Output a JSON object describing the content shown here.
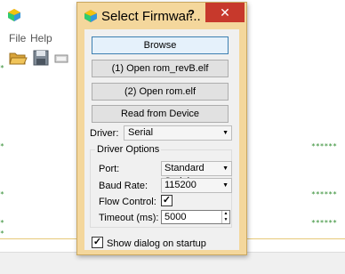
{
  "background_app": {
    "menu": [
      {
        "label": "File"
      },
      {
        "label": "Help"
      }
    ],
    "toolbar_icons": [
      "folder-open-icon",
      "save-icon",
      "chip-icon"
    ]
  },
  "dialog": {
    "title": "Select Firmwar...",
    "help_label": "?",
    "close_label": "✕",
    "buttons": {
      "browse": "Browse",
      "open_revb": "(1) Open rom_revB.elf",
      "open_rom": "(2) Open rom.elf",
      "read_device": "Read from Device"
    },
    "driver": {
      "label": "Driver:",
      "value": "Serial"
    },
    "driver_options": {
      "title": "Driver Options",
      "port": {
        "label": "Port:",
        "value": "Standard Serial"
      },
      "baud": {
        "label": "Baud Rate:",
        "value": "115200"
      },
      "flow": {
        "label": "Flow Control:",
        "checked": true
      },
      "timeout": {
        "label": "Timeout (ms):",
        "value": "5000"
      }
    },
    "show_dialog": {
      "label": "Show dialog on startup",
      "checked": true
    }
  },
  "colors": {
    "dialog_frame": "#f4d79c",
    "close_button": "#c7392c",
    "star_green": "#2e8b2e"
  }
}
